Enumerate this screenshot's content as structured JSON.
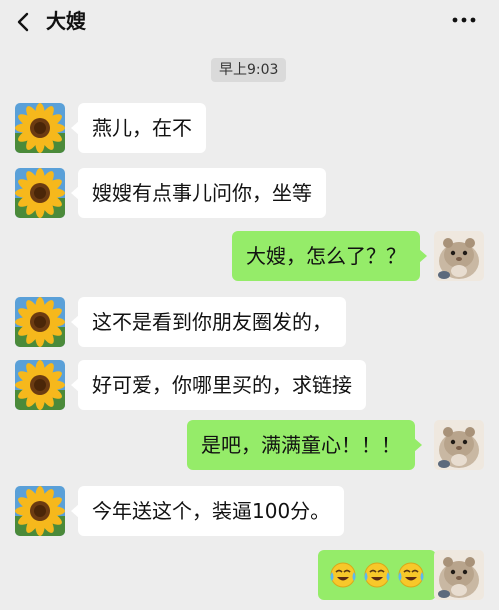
{
  "header": {
    "back_icon": "chevron-left-icon",
    "title": "大嫂",
    "more_icon": "ellipsis-icon"
  },
  "timestamp": "早上9:03",
  "colors": {
    "background": "#ededed",
    "incoming_bubble": "#ffffff",
    "outgoing_bubble": "#95ec69"
  },
  "messages": [
    {
      "sender": "大嫂",
      "direction": "incoming",
      "text": "燕儿，在不"
    },
    {
      "sender": "大嫂",
      "direction": "incoming",
      "text": "嫂嫂有点事儿问你，坐等"
    },
    {
      "sender": "me",
      "direction": "outgoing",
      "text": "大嫂，怎么了？？"
    },
    {
      "sender": "大嫂",
      "direction": "incoming",
      "text": "这不是看到你朋友圈发的，"
    },
    {
      "sender": "大嫂",
      "direction": "incoming",
      "text": "好可爱，你哪里买的，求链接"
    },
    {
      "sender": "me",
      "direction": "outgoing",
      "text": "是吧，满满童心！！！"
    },
    {
      "sender": "大嫂",
      "direction": "incoming",
      "text": "今年送这个，装逼100分。"
    },
    {
      "sender": "me",
      "direction": "outgoing",
      "emoji": [
        "tears-of-joy-emoji",
        "tears-of-joy-emoji",
        "tears-of-joy-emoji"
      ]
    }
  ],
  "avatars": {
    "incoming": "sunflower-avatar",
    "outgoing": "hamster-avatar"
  }
}
